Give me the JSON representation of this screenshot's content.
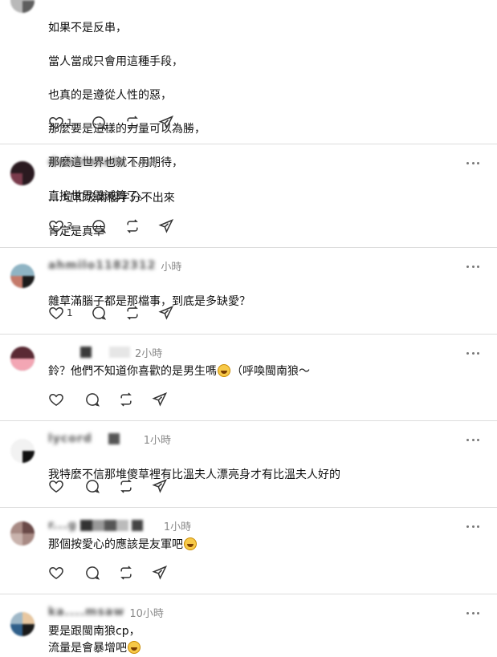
{
  "posts": [
    {
      "username": "",
      "time": "",
      "lines": [
        "如果不是反串，",
        "當人當成只會用這種手段，",
        "也真的是遵從人性的惡，",
        "那麼要是這樣的力量可以為勝，",
        "那麼這世界也就不用期待，",
        "直接世界毀滅算了。"
      ],
      "like_count": "1"
    },
    {
      "username": "debbiecats",
      "time": "1小時",
      "lines": [
        "....垃和圾兩個字分不出來",
        "肯定是真草"
      ],
      "like_count": "3"
    },
    {
      "username": "ahmilo1182312",
      "time": "小時",
      "lines": [
        "雜草滿腦子都是那檔事，到底是多缺愛？"
      ],
      "like_count": "1"
    },
    {
      "username": "",
      "time": "2小時",
      "text_before": "鈴？他們不知道你喜歡的是男生嗎",
      "text_after": "（呼喚閩南狼～",
      "like_count": ""
    },
    {
      "username": "lycord",
      "time": "1小時",
      "lines": [
        "我特麼不信那堆傻草裡有比溫夫人漂亮身才有比溫夫人好的"
      ],
      "like_count": ""
    },
    {
      "username": "r...g",
      "time": "1小時",
      "text_before": "那個按愛心的應該是友軍吧",
      "text_after": "",
      "like_count": ""
    },
    {
      "username": "ka....msaw",
      "time": "10小時",
      "line1": "要是跟閩南狼cp，",
      "line2": "流量是會暴增吧",
      "like_count": ""
    }
  ],
  "icons": [
    "heart-icon",
    "comment-icon",
    "repost-icon",
    "share-icon",
    "more-icon",
    "laughing-emoji",
    "smiling-emoji"
  ]
}
